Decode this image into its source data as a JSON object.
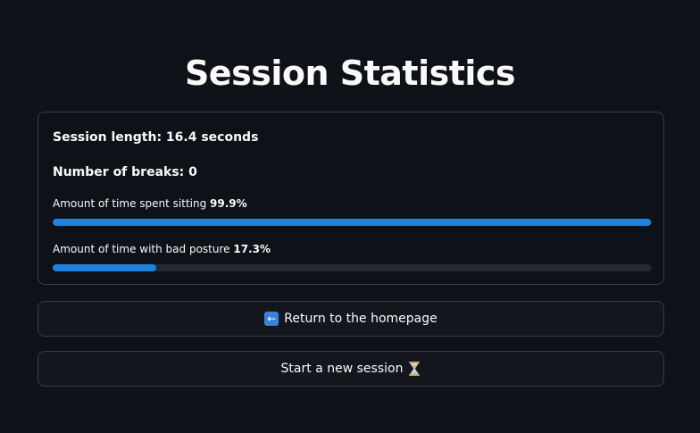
{
  "page": {
    "title": "Session Statistics"
  },
  "stats": {
    "session_length": "Session length: 16.4 seconds",
    "breaks": "Number of breaks: 0",
    "sitting": {
      "label": "Amount of time spent sitting",
      "value_text": "99.9%",
      "fraction": 0.999
    },
    "bad_posture": {
      "label": "Amount of time with bad posture",
      "value_text": "17.3%",
      "fraction": 0.173
    }
  },
  "buttons": {
    "return_label": "Return to the homepage",
    "return_icon": "left-arrow-icon",
    "new_session_label": "Start a new session",
    "new_session_icon": "hourglass-icon"
  },
  "colors": {
    "background": "#0e1117",
    "accent": "#1c83e1",
    "track": "#262830",
    "border": "#3a3d45"
  }
}
